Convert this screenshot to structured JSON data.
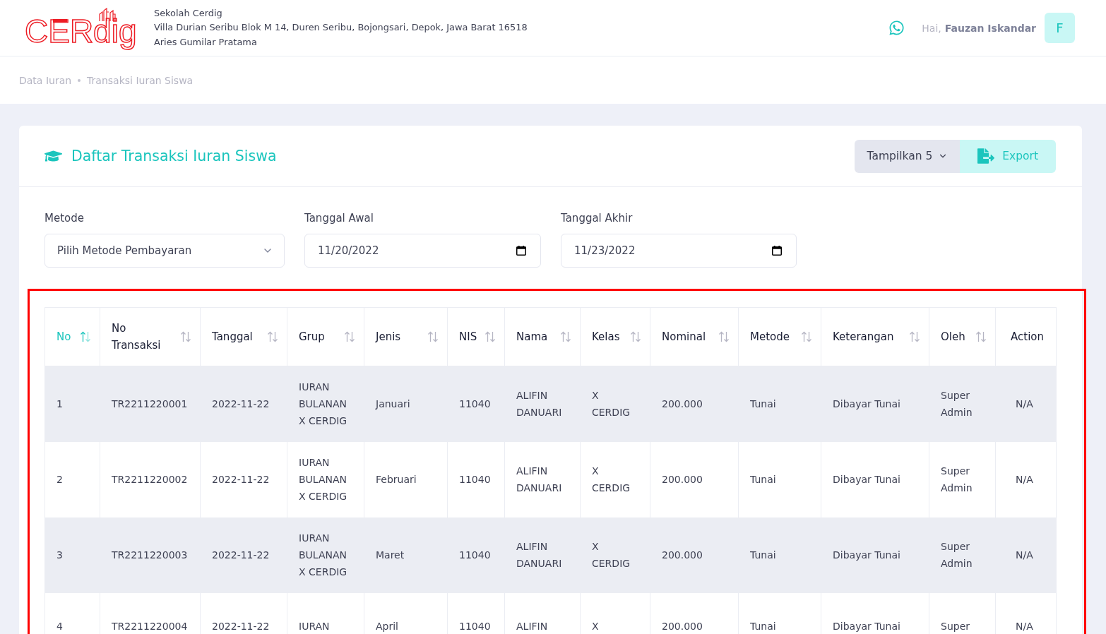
{
  "logo": {
    "text": "CERdig"
  },
  "school": {
    "name": "Sekolah Cerdig",
    "address": "Villa Durian Seribu Blok M 14, Duren Seribu, Bojongsari, Depok, Jawa Barat 16518",
    "principal": "Aries Gumilar Pratama"
  },
  "user": {
    "greeting": "Hai,",
    "name": "Fauzan Iskandar",
    "initial": "F"
  },
  "breadcrumb": [
    "Data Iuran",
    "Transaksi Iuran Siswa"
  ],
  "card": {
    "title": "Daftar Transaksi Iuran Siswa",
    "page_size_button": "Tampilkan 5",
    "export_button": "Export"
  },
  "filters": [
    {
      "kind": "select",
      "label": "Metode",
      "value": "Pilih Metode Pembayaran"
    },
    {
      "kind": "date",
      "label": "Tanggal Awal",
      "value": "11/20/2022"
    },
    {
      "kind": "date",
      "label": "Tanggal Akhir",
      "value": "11/23/2022"
    }
  ],
  "table": {
    "highlighted": true,
    "columns": [
      {
        "label": "No",
        "sortable": true,
        "sorted": true
      },
      {
        "label": "No Transaksi",
        "sortable": true,
        "sorted": false
      },
      {
        "label": "Tanggal",
        "sortable": true,
        "sorted": false
      },
      {
        "label": "Grup",
        "sortable": true,
        "sorted": false
      },
      {
        "label": "Jenis",
        "sortable": true,
        "sorted": false
      },
      {
        "label": "NIS",
        "sortable": true,
        "sorted": false
      },
      {
        "label": "Nama",
        "sortable": true,
        "sorted": false
      },
      {
        "label": "Kelas",
        "sortable": true,
        "sorted": false
      },
      {
        "label": "Nominal",
        "sortable": true,
        "sorted": false
      },
      {
        "label": "Metode",
        "sortable": true,
        "sorted": false
      },
      {
        "label": "Keterangan",
        "sortable": true,
        "sorted": false
      },
      {
        "label": "Oleh",
        "sortable": true,
        "sorted": false
      },
      {
        "label": "Action",
        "sortable": false,
        "sorted": false
      }
    ],
    "rows": [
      {
        "cells": [
          "1",
          "TR2211220001",
          "2022-11-22",
          "IURAN BULANAN X CERDIG",
          "Januari",
          "11040",
          "ALIFIN DANUARI",
          "X CERDIG",
          "200.000",
          "Tunai",
          "Dibayar Tunai",
          "Super Admin",
          "N/A"
        ]
      },
      {
        "cells": [
          "2",
          "TR2211220002",
          "2022-11-22",
          "IURAN BULANAN X CERDIG",
          "Februari",
          "11040",
          "ALIFIN DANUARI",
          "X CERDIG",
          "200.000",
          "Tunai",
          "Dibayar Tunai",
          "Super Admin",
          "N/A"
        ]
      },
      {
        "cells": [
          "3",
          "TR2211220003",
          "2022-11-22",
          "IURAN BULANAN X CERDIG",
          "Maret",
          "11040",
          "ALIFIN DANUARI",
          "X CERDIG",
          "200.000",
          "Tunai",
          "Dibayar Tunai",
          "Super Admin",
          "N/A"
        ]
      },
      {
        "cells": [
          "4",
          "TR2211220004",
          "2022-11-22",
          "IURAN",
          "April",
          "11040",
          "ALIFIN",
          "X",
          "200.000",
          "Tunai",
          "Dibayar Tunai",
          "Super",
          "N/A"
        ]
      }
    ]
  }
}
